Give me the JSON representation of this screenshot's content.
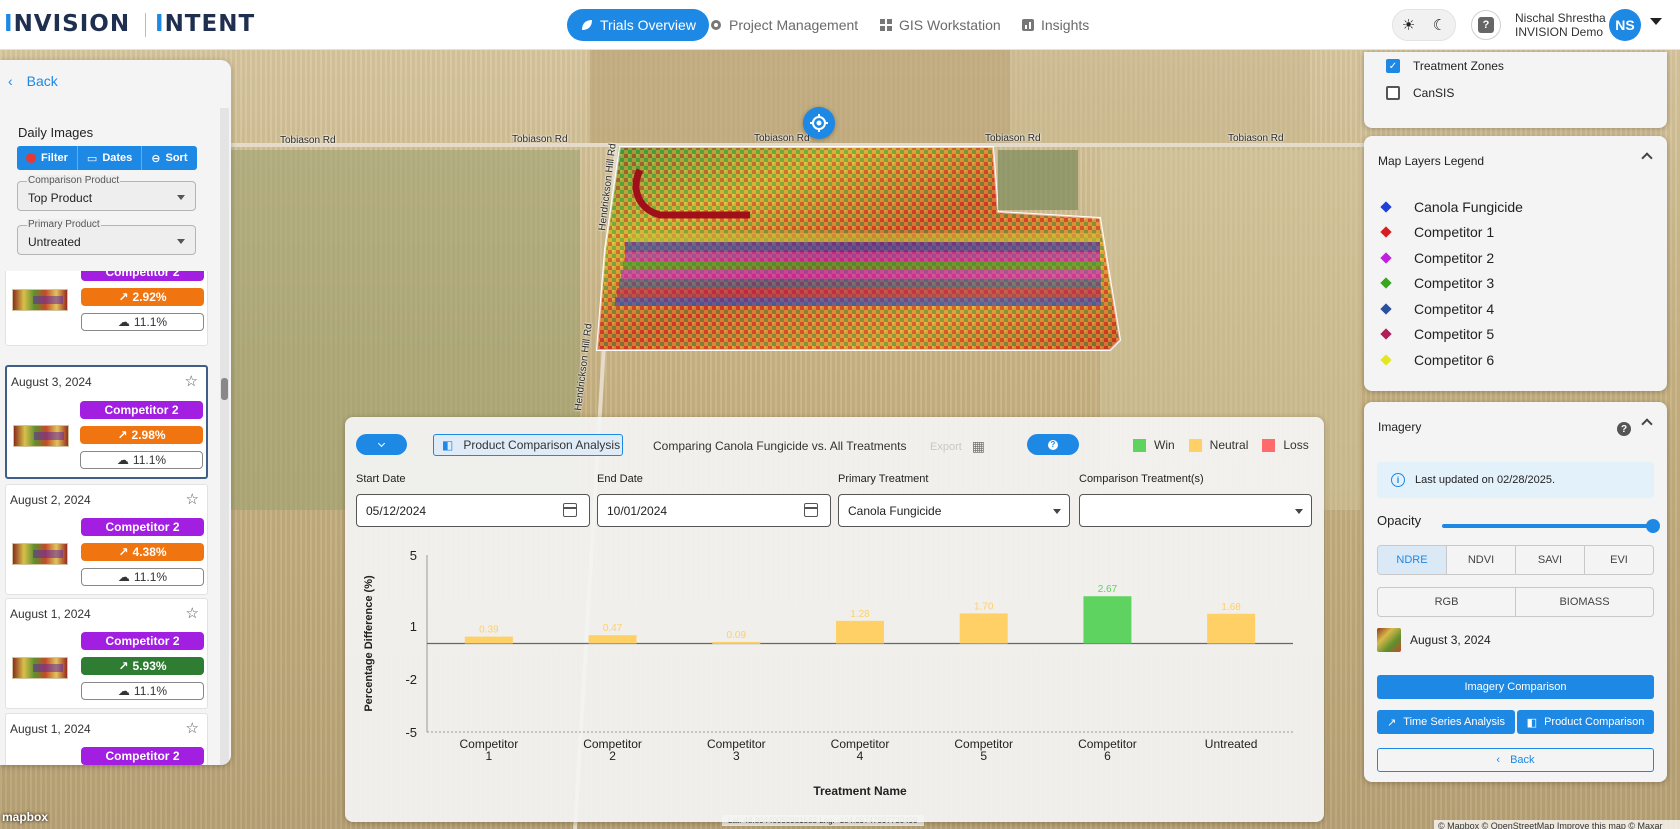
{
  "header": {
    "logo_left_a": "I",
    "logo_left_b": "NVISION",
    "logo_right_a": "I",
    "logo_right_b": "NTENT",
    "nav": [
      {
        "label": "Trials Overview",
        "active": true,
        "icon": "leaf-icon"
      },
      {
        "label": "Project Management",
        "active": false,
        "icon": "gear-icon"
      },
      {
        "label": "GIS Workstation",
        "active": false,
        "icon": "grid-icon"
      },
      {
        "label": "Insights",
        "active": false,
        "icon": "bar-chart-icon"
      }
    ],
    "help_glyph": "?",
    "user_name": "Nischal Shrestha",
    "user_org": "INVISION Demo",
    "user_initials": "NS"
  },
  "map": {
    "road_labels": [
      "Tobiason Rd",
      "Tobiason Rd",
      "Tobiason Rd",
      "Tobiason Rd",
      "Tobiason Rd",
      "Hendrickson Hill Rd",
      "Hendrickson Hill Rd"
    ],
    "mapbox_logo": "mapbox",
    "coordinates": "Lat: 48.80440050981583 Lng: -104.09747997730499",
    "attribution": "© Mapbox © OpenStreetMap Improve this map © Maxar"
  },
  "left_panel": {
    "back_label": "Back",
    "daily_images_title": "Daily Images",
    "filter_label": "Filter",
    "dates_label": "Dates",
    "sort_label": "Sort",
    "comparison_product_label": "Comparison Product",
    "comparison_product_value": "Top Product",
    "primary_product_label": "Primary Product",
    "primary_product_value": "Untreated",
    "cards": [
      {
        "date": "",
        "product": "Competitor 2",
        "change": "2.92%",
        "change_color": "orange",
        "cloud": "11.1%"
      },
      {
        "date": "August 3, 2024",
        "product": "Competitor 2",
        "change": "2.98%",
        "change_color": "orange",
        "cloud": "11.1%",
        "selected": true
      },
      {
        "date": "August 2, 2024",
        "product": "Competitor 2",
        "change": "4.38%",
        "change_color": "orange",
        "cloud": "11.1%"
      },
      {
        "date": "August 1, 2024",
        "product": "Competitor 2",
        "change": "5.93%",
        "change_color": "green",
        "cloud": "11.1%"
      },
      {
        "date": "August 1, 2024",
        "product": "Competitor 2",
        "change": "",
        "change_color": "orange",
        "cloud": ""
      }
    ]
  },
  "layers": {
    "items": [
      {
        "label": "Treatment Zones",
        "checked": true
      },
      {
        "label": "CanSIS",
        "checked": false
      }
    ]
  },
  "legend": {
    "title": "Map Layers Legend",
    "items": [
      {
        "label": "Canola Fungicide",
        "color": "#1f3fd6"
      },
      {
        "label": "Competitor 1",
        "color": "#d81e1e"
      },
      {
        "label": "Competitor 2",
        "color": "#c21ee0"
      },
      {
        "label": "Competitor 3",
        "color": "#3aa51f"
      },
      {
        "label": "Competitor 4",
        "color": "#2d4fa0"
      },
      {
        "label": "Competitor 5",
        "color": "#b01e5a"
      },
      {
        "label": "Competitor 6",
        "color": "#e3e81e"
      }
    ]
  },
  "imagery": {
    "title": "Imagery",
    "help_glyph": "?",
    "last_updated": "Last updated on 02/28/2025.",
    "opacity_label": "Opacity",
    "opacity": 1.0,
    "indices": [
      "NDRE",
      "NDVI",
      "SAVI",
      "EVI"
    ],
    "active_index": "NDRE",
    "other_modes": [
      "RGB",
      "BIOMASS"
    ],
    "latest_date": "August 3, 2024",
    "imagery_comparison": "Imagery Comparison",
    "time_series": "Time Series Analysis",
    "product_comparison": "Product Comparison",
    "back": "Back"
  },
  "comparison": {
    "tab_label": "Product Comparison Analysis",
    "subtitle": "Comparing Canola Fungicide vs. All Treatments",
    "export_label": "Export",
    "legend": [
      {
        "label": "Win",
        "color": "#5fd35f"
      },
      {
        "label": "Neutral",
        "color": "#ffd066"
      },
      {
        "label": "Loss",
        "color": "#ff6b6b"
      }
    ],
    "start_date_label": "Start Date",
    "start_date": "05/12/2024",
    "end_date_label": "End Date",
    "end_date": "10/01/2024",
    "primary_label": "Primary Treatment",
    "primary_value": "Canola Fungicide",
    "comparison_label": "Comparison Treatment(s)",
    "comparison_value": ""
  },
  "chart_data": {
    "type": "bar",
    "categories": [
      "Competitor 1",
      "Competitor 2",
      "Competitor 3",
      "Competitor 4",
      "Competitor 5",
      "Competitor 6",
      "Untreated"
    ],
    "values": [
      0.39,
      0.47,
      0.09,
      1.28,
      1.7,
      2.67,
      1.68
    ],
    "value_labels": [
      "0.39",
      "0.47",
      "0.09",
      "1.28",
      "1.70",
      "2.67",
      "1.68"
    ],
    "outcomes": [
      "Neutral",
      "Neutral",
      "Neutral",
      "Neutral",
      "Neutral",
      "Win",
      "Neutral"
    ],
    "colors": {
      "Win": "#5fd35f",
      "Neutral": "#ffd066",
      "Loss": "#ff6b6b"
    },
    "xlabel": "Treatment Name",
    "ylabel": "Percentage Difference (%)",
    "yticks": [
      5,
      1,
      -2,
      -5
    ],
    "ylim": [
      -5,
      5
    ],
    "grid": false
  }
}
